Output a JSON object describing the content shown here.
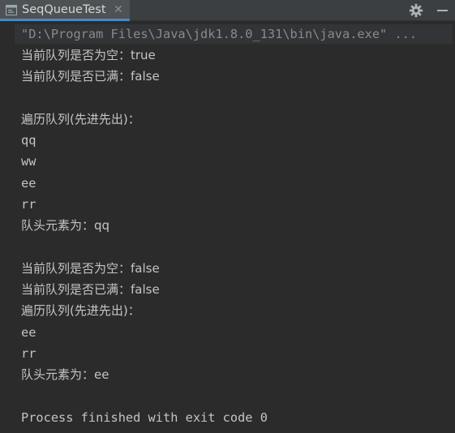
{
  "tab": {
    "title": "SeqQueueTest",
    "close_glyph": "✕",
    "icon": "run-console-icon"
  },
  "toolbar": {
    "settings_icon": "gear-icon",
    "minimize_icon": "minimize-icon"
  },
  "console": {
    "command": "\"D:\\Program Files\\Java\\jdk1.8.0_131\\bin\\java.exe\" ...",
    "lines": [
      "当前队列是否为空：true",
      "当前队列是否已满：false",
      "",
      "遍历队列(先进先出)：",
      "qq",
      "ww",
      "ee",
      "rr",
      "队头元素为：qq",
      "",
      "当前队列是否为空：false",
      "当前队列是否已满：false",
      "遍历队列(先进先出)：",
      "ee",
      "rr",
      "队头元素为：ee",
      "",
      "Process finished with exit code 0"
    ]
  },
  "colors": {
    "background": "#2b2b2b",
    "text": "#c4c4c4",
    "command_text": "#8a8a8a",
    "tab_underline": "#4a88c7"
  }
}
